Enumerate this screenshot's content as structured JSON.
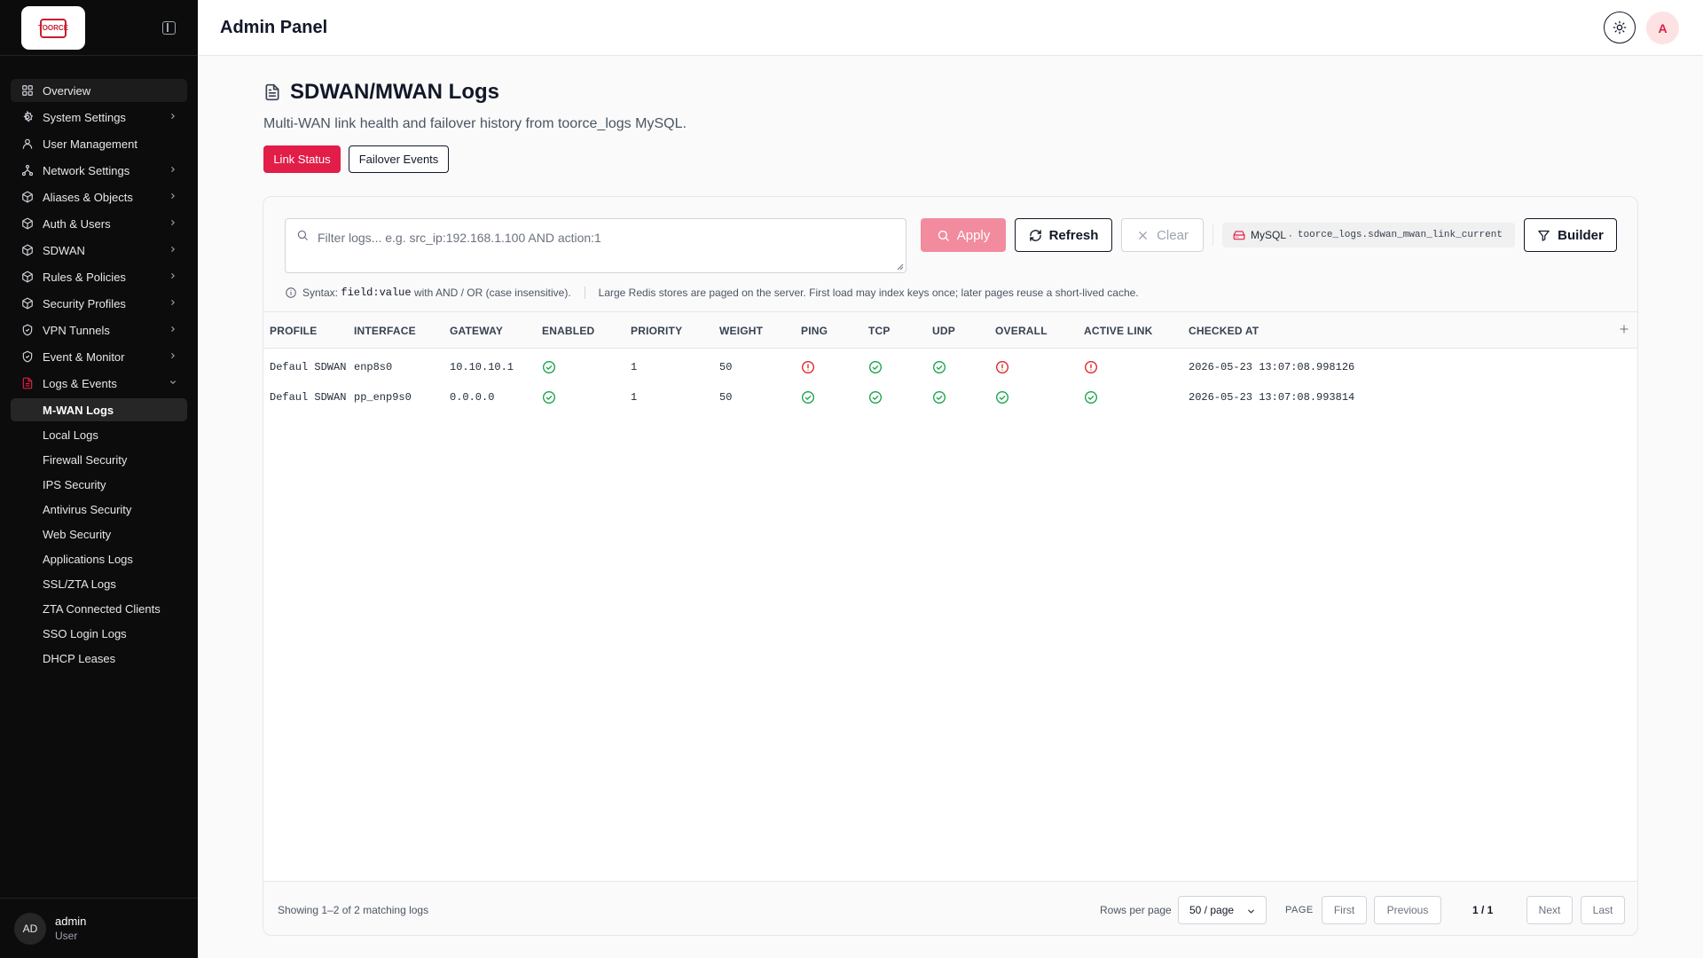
{
  "app": {
    "title": "Admin Panel",
    "logo_text": "TOORCE",
    "avatar_initial": "A"
  },
  "sidebar": {
    "items": [
      {
        "label": "Overview",
        "icon": "grid-icon",
        "chevron": false
      },
      {
        "label": "System Settings",
        "icon": "gear-icon",
        "chevron": true
      },
      {
        "label": "User Management",
        "icon": "user-icon",
        "chevron": false
      },
      {
        "label": "Network Settings",
        "icon": "network-icon",
        "chevron": true
      },
      {
        "label": "Aliases & Objects",
        "icon": "cube-icon",
        "chevron": true
      },
      {
        "label": "Auth & Users",
        "icon": "cube-icon",
        "chevron": true
      },
      {
        "label": "SDWAN",
        "icon": "cube-icon",
        "chevron": true
      },
      {
        "label": "Rules & Policies",
        "icon": "cube-icon",
        "chevron": true
      },
      {
        "label": "Security Profiles",
        "icon": "cube-icon",
        "chevron": true
      },
      {
        "label": "VPN Tunnels",
        "icon": "shield-icon",
        "chevron": true
      },
      {
        "label": "Event & Monitor",
        "icon": "shield-icon",
        "chevron": true
      },
      {
        "label": "Logs & Events",
        "icon": "document-icon",
        "chevron": true
      }
    ],
    "sub_items": [
      "M-WAN Logs",
      "Local Logs",
      "Firewall Security",
      "IPS Security",
      "Antivirus Security",
      "Web Security",
      "Applications Logs",
      "SSL/ZTA Logs",
      "ZTA Connected Clients",
      "SSO Login Logs",
      "DHCP Leases"
    ],
    "user": {
      "initials": "AD",
      "name": "admin",
      "role": "User"
    }
  },
  "page": {
    "title": "SDWAN/MWAN Logs",
    "description": "Multi-WAN link health and failover history from toorce_logs MySQL.",
    "tabs": {
      "link_status": "Link Status",
      "failover_events": "Failover Events"
    }
  },
  "filter": {
    "placeholder": "Filter logs... e.g. src_ip:192.168.1.100 AND action:1",
    "value": "",
    "apply_label": "Apply",
    "refresh_label": "Refresh",
    "clear_label": "Clear",
    "source_label": "MySQL ·",
    "source_table": "toorce_logs.sdwan_mwan_link_current",
    "builder_label": "Builder",
    "syntax_prefix": "Syntax:",
    "syntax_code": "field:value",
    "syntax_suffix": "with AND / OR (case insensitive).",
    "note": "Large Redis stores are paged on the server. First load may index keys once; later pages reuse a short-lived cache."
  },
  "table": {
    "columns": [
      "PROFILE",
      "INTERFACE",
      "GATEWAY",
      "ENABLED",
      "PRIORITY",
      "WEIGHT",
      "PING",
      "TCP",
      "UDP",
      "OVERALL",
      "ACTIVE LINK",
      "CHECKED AT"
    ],
    "rows": [
      {
        "profile": "Defaul SDWAN",
        "interface": "enp8s0",
        "gateway": "10.10.10.1",
        "enabled": "ok",
        "priority": "1",
        "weight": "50",
        "ping": "alert",
        "tcp": "ok",
        "udp": "ok",
        "overall": "alert",
        "active_link": "alert",
        "checked_at": "2026-05-23 13:07:08.998126"
      },
      {
        "profile": "Defaul SDWAN",
        "interface": "pp_enp9s0",
        "gateway": "0.0.0.0",
        "enabled": "ok",
        "priority": "1",
        "weight": "50",
        "ping": "ok",
        "tcp": "ok",
        "udp": "ok",
        "overall": "ok",
        "active_link": "ok",
        "checked_at": "2026-05-23 13:07:08.993814"
      }
    ]
  },
  "pagination": {
    "summary": "Showing 1–2 of 2 matching logs",
    "rows_per_page_label": "Rows per page",
    "rows_per_page_value": "50 / page",
    "page_label": "PAGE",
    "first": "First",
    "previous": "Previous",
    "page_indicator": "1 / 1",
    "next": "Next",
    "last": "Last"
  },
  "colors": {
    "accent": "#e11d48",
    "ok": "#16a34a",
    "alert": "#dc2626",
    "sidebar_bg": "#0c0c0c"
  }
}
